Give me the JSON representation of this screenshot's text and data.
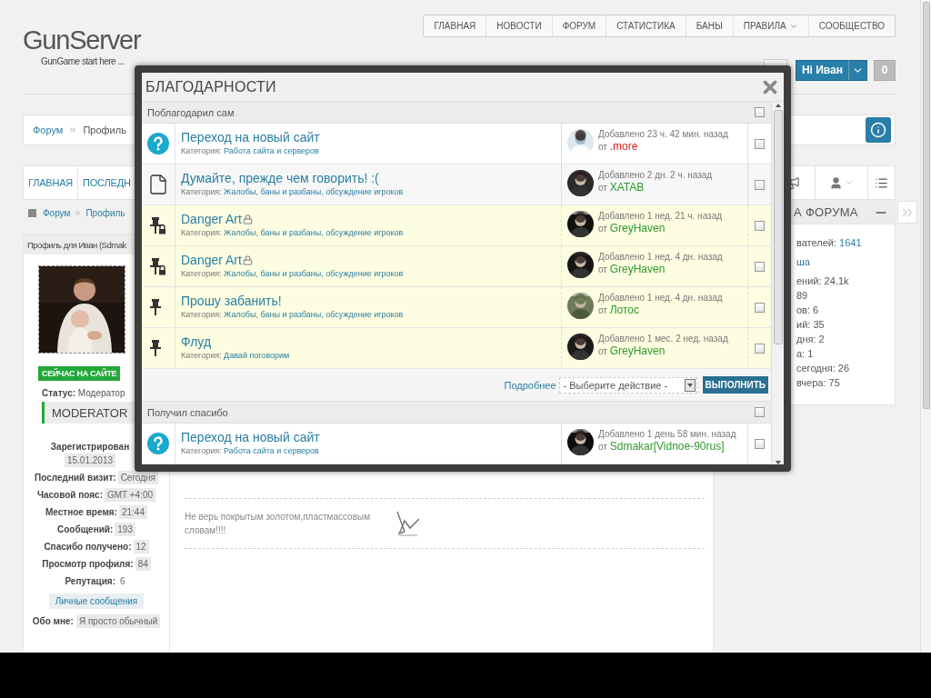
{
  "header": {
    "logo": "GunServer",
    "tagline": "GunGame start here ...",
    "nav": [
      {
        "label": "ГЛАВНАЯ",
        "dropdown": false
      },
      {
        "label": "НОВОСТИ",
        "dropdown": false
      },
      {
        "label": "ФОРУМ",
        "dropdown": false
      },
      {
        "label": "СТАТИСТИКА",
        "dropdown": false
      },
      {
        "label": "БАНЫ",
        "dropdown": false
      },
      {
        "label": "ПРАВИЛА",
        "dropdown": true
      },
      {
        "label": "СООБЩЕСТВО",
        "dropdown": false
      }
    ],
    "user_button": "Hi Иван",
    "notifications": "0"
  },
  "breadcrumb": [
    "Форум",
    "Профиль"
  ],
  "tabs": [
    {
      "label": "ГЛАВНАЯ",
      "selected": false
    },
    {
      "label": "ПОСЛЕДН",
      "selected": false
    }
  ],
  "subcrumb": [
    "Форум",
    "Профиль"
  ],
  "profile": {
    "title": "Профиль для Иван (Sdmak",
    "online": "СЕЙЧАС НА САЙТЕ",
    "status_label": "Статус:",
    "status": "Модератор",
    "group": "MODERATOR",
    "stats": [
      {
        "kind": "stacked",
        "label": "Зарегистрирован",
        "value": "15.01.2013"
      },
      {
        "kind": "tag",
        "label": "Последний визит:",
        "value": "Сегодня"
      },
      {
        "kind": "tag",
        "label": "Часовой пояс:",
        "value": "GMT +4:00"
      },
      {
        "kind": "tag",
        "label": "Местное время:",
        "value": "21:44"
      },
      {
        "kind": "tag",
        "label": "Сообщений:",
        "value": "193"
      },
      {
        "kind": "tag",
        "label": "Спасибо получено:",
        "value": "12"
      },
      {
        "kind": "tag",
        "label": "Просмотр профиля:",
        "value": "84"
      },
      {
        "kind": "plain",
        "label": "Репутация:",
        "value": "6"
      }
    ],
    "messages_button": "Личные сообщения",
    "about_label": "Обо мне:",
    "about": "Я просто обычный"
  },
  "signature": "Не верь покрытым золотом,пластмассовым словам!!!!",
  "sidebar": {
    "title": "А ФОРУМА",
    "lines": [
      {
        "text": "вателей:",
        "link": "1641"
      },
      {
        "link": "ша"
      },
      {
        "text": "ений: 24.1k"
      },
      {
        "text": "89"
      },
      {
        "text": "ов: 6"
      },
      {
        "text": "ий: 35"
      },
      {
        "text": "дня: 2"
      },
      {
        "text": "а: 1"
      },
      {
        "text": "сегодня: 26"
      },
      {
        "text": "вчера: 75"
      }
    ]
  },
  "modal": {
    "title": "БЛАГОДАРНОСТИ",
    "sections": [
      {
        "title": "Поблагодарил сам",
        "checked": false,
        "items": [
          {
            "kind": "question",
            "title": "Переход на новый сайт",
            "locked": false,
            "highlighted": false,
            "category_label": "Категория:",
            "category": "Работа сайта и серверов",
            "added": "Добавлено 23 ч. 42 мин. назад",
            "by": "от",
            "author": ".more",
            "color": "#d9251d",
            "checked": false
          },
          {
            "kind": "document",
            "title": "Думайте, прежде чем говорить! :(",
            "locked": false,
            "highlighted": false,
            "category_label": "Категория:",
            "category": "Жалобы, баны и разбаны, обсуждение игроков",
            "added": "Добавлено 2 дн. 2 ч. назад",
            "by": "от",
            "author": "XATAB",
            "color": "#2e9a2e",
            "checked": false
          },
          {
            "kind": "pin",
            "title": "Danger Art",
            "locked": true,
            "highlighted": true,
            "category_label": "Категория:",
            "category": "Жалобы, баны и разбаны, обсуждение игроков",
            "added": "Добавлено 1 нед. 21 ч. назад",
            "by": "от",
            "author": "GreyHaven",
            "color": "#2e9a2e",
            "checked": false
          },
          {
            "kind": "pin",
            "title": "Danger Art",
            "locked": true,
            "highlighted": true,
            "category_label": "Категория:",
            "category": "Жалобы, баны и разбаны, обсуждение игроков",
            "added": "Добавлено 1 нед. 4 дн. назад",
            "by": "от",
            "author": "GreyHaven",
            "color": "#2e9a2e",
            "checked": false
          },
          {
            "kind": "pin",
            "title": "Прошу забанить!",
            "locked": false,
            "highlighted": true,
            "category_label": "Категория:",
            "category": "Жалобы, баны и разбаны, обсуждение игроков",
            "added": "Добавлено 1 нед. 4 дн. назад",
            "by": "от",
            "author": "Лотос",
            "color": "#2e9a2e",
            "checked": false
          },
          {
            "kind": "pin",
            "title": "Флуд",
            "locked": false,
            "highlighted": true,
            "category_label": "Категория:",
            "category": "Давай поговорим",
            "added": "Добавлено 1 мес. 2 нед. назад",
            "by": "от",
            "author": "GreyHaven",
            "color": "#2e9a2e",
            "checked": false
          }
        ],
        "actions": {
          "more": "Подробнее",
          "select_placeholder": "- Выберите действие -",
          "submit": "ВЫПОЛНИТЬ"
        }
      },
      {
        "title": "Получил спасибо",
        "checked": false,
        "items": [
          {
            "kind": "question",
            "title": "Переход на новый сайт",
            "locked": false,
            "highlighted": false,
            "category_label": "Категория:",
            "category": "Работа сайта и серверов",
            "added": "Добавлено 1 день 58 мин. назад",
            "by": "от",
            "author": "Sdmakar[Vidnoe-90rus]",
            "color": "#2e9a2e",
            "checked": false
          }
        ]
      }
    ]
  }
}
